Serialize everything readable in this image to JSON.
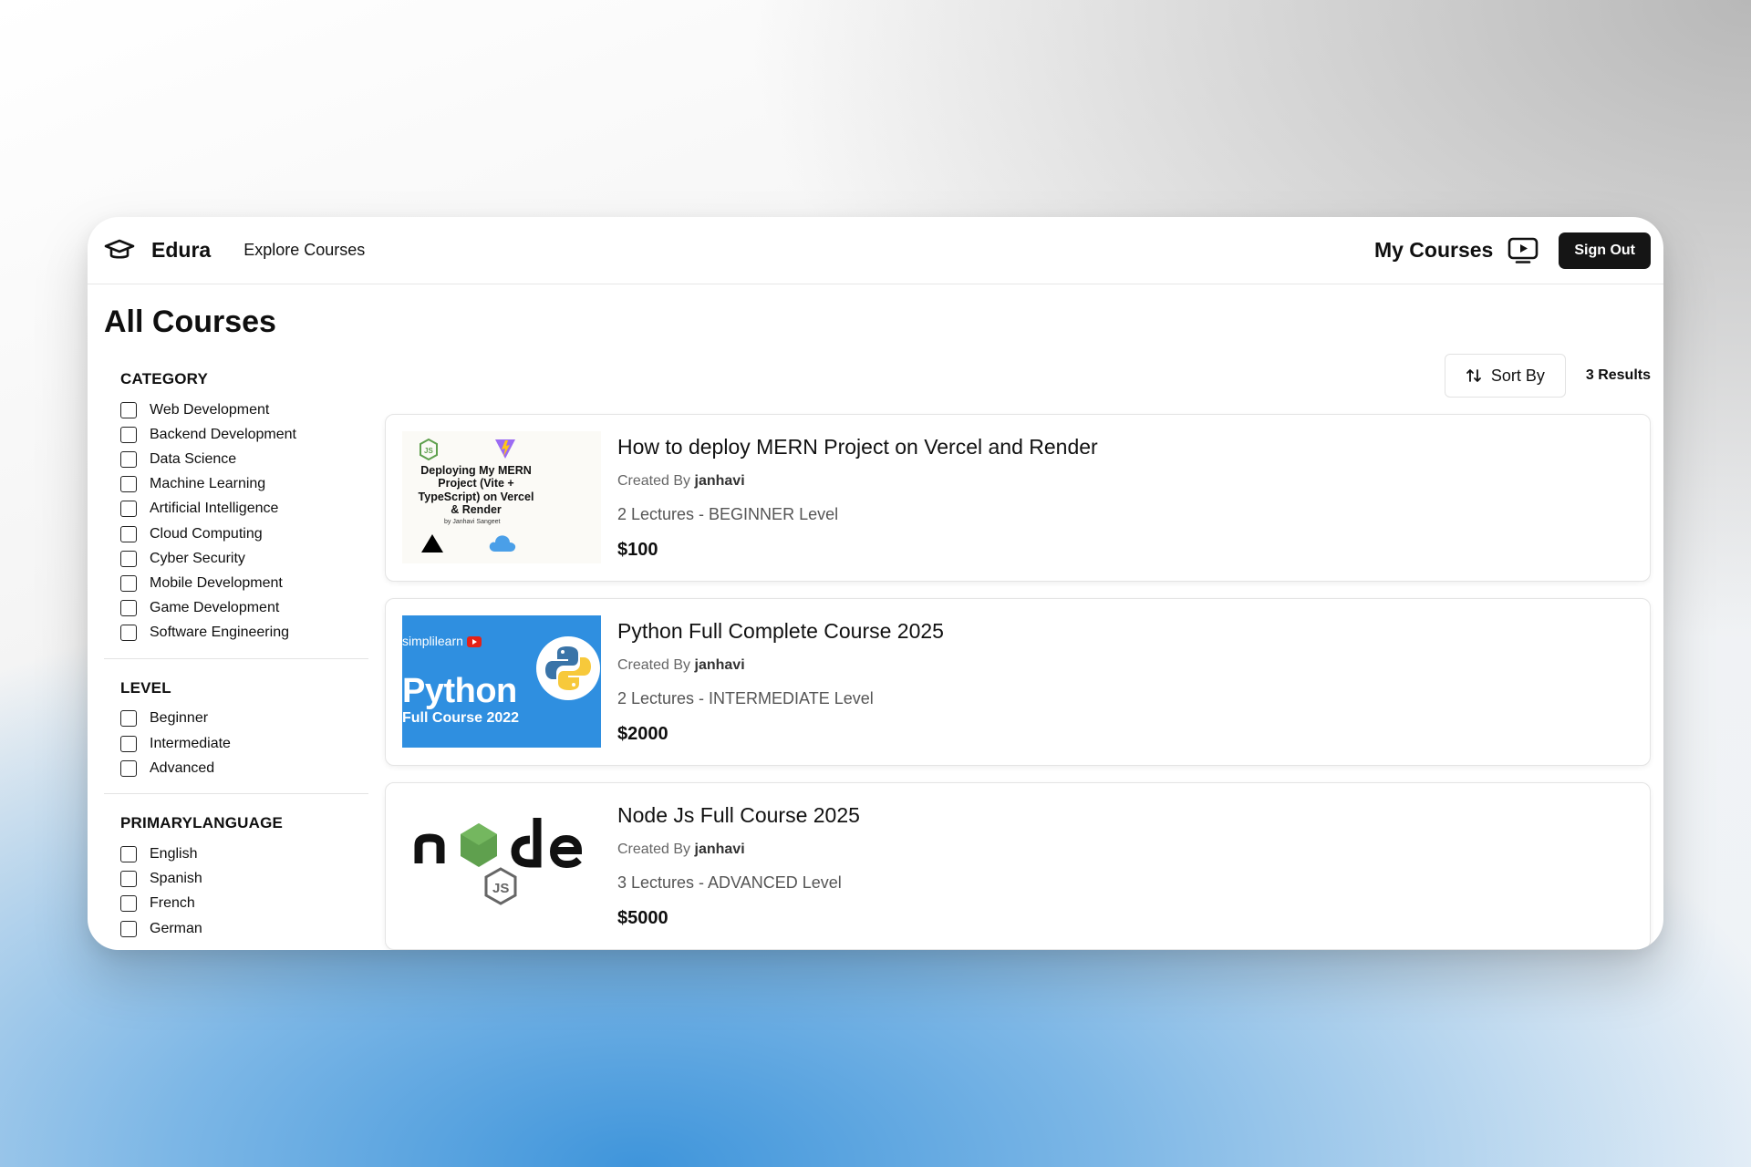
{
  "header": {
    "brand": "Edura",
    "nav_explore": "Explore Courses",
    "my_courses": "My Courses",
    "sign_out": "Sign Out"
  },
  "page": {
    "title": "All Courses"
  },
  "filters": {
    "category": {
      "title": "CATEGORY",
      "items": [
        "Web Development",
        "Backend Development",
        "Data Science",
        "Machine Learning",
        "Artificial Intelligence",
        "Cloud Computing",
        "Cyber Security",
        "Mobile Development",
        "Game Development",
        "Software Engineering"
      ]
    },
    "level": {
      "title": "LEVEL",
      "items": [
        "Beginner",
        "Intermediate",
        "Advanced"
      ]
    },
    "language": {
      "title": "PRIMARYLANGUAGE",
      "items": [
        "English",
        "Spanish",
        "French",
        "German"
      ]
    }
  },
  "toolbar": {
    "sort_label": "Sort By",
    "results": "3 Results"
  },
  "courses": [
    {
      "title": "How to deploy MERN Project on Vercel and Render",
      "created_by_label": "Created By",
      "author": "janhavi",
      "meta": "2 Lectures - BEGINNER Level",
      "price": "$100",
      "thumb_text": "Deploying My MERN Project (Vite + TypeScript) on Vercel & Render",
      "thumb_sub": "by Janhavi Sangeet"
    },
    {
      "title": "Python Full Complete Course 2025",
      "created_by_label": "Created By",
      "author": "janhavi",
      "meta": "2 Lectures - INTERMEDIATE Level",
      "price": "$2000",
      "thumb_brand": "simplilearn",
      "thumb_title": "Python",
      "thumb_sub": "Full Course 2022"
    },
    {
      "title": "Node Js Full Course 2025",
      "created_by_label": "Created By",
      "author": "janhavi",
      "meta": "3 Lectures - ADVANCED Level",
      "price": "$5000"
    }
  ],
  "colors": {
    "primary_button": "#151515",
    "python_thumb": "#2f8fe0",
    "node_green": "#5fa04e"
  }
}
